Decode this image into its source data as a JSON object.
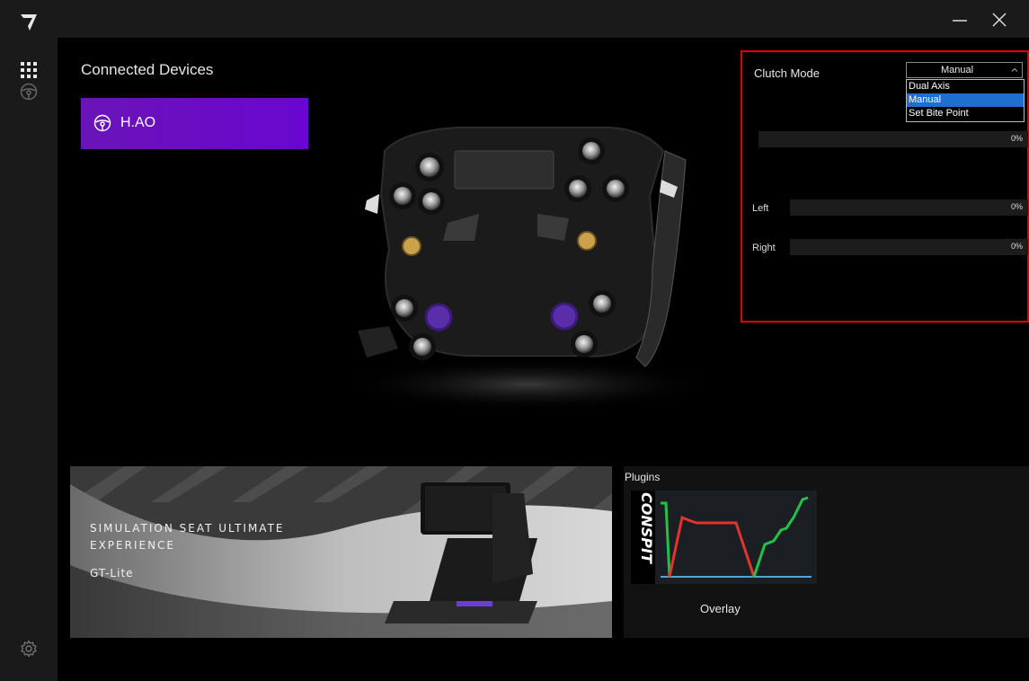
{
  "rail": {
    "logo": "conspit-logo",
    "icons": [
      "apps-grid-icon",
      "steering-wheel-icon",
      "gear-icon"
    ]
  },
  "window": {
    "minimize_icon": "minimize-icon",
    "close_icon": "close-icon"
  },
  "devices": {
    "heading": "Connected Devices",
    "items": [
      {
        "label": "H.AO",
        "icon": "steering-wheel-icon"
      }
    ]
  },
  "clutch": {
    "title": "Clutch Mode",
    "selected": "Manual",
    "options": [
      "Dual Axis",
      "Manual",
      "Set Bite Point"
    ],
    "main_bar": {
      "value_text": "0%",
      "value": 0
    },
    "left": {
      "label": "Left",
      "value_text": "0%",
      "value": 0
    },
    "right": {
      "label": "Right",
      "value_text": "0%",
      "value": 0
    },
    "highlight_color": "#e00000",
    "selected_option_color": "#1f6fd0"
  },
  "promo": {
    "line1": "SIMULATION SEAT  ULTIMATE",
    "line2": "EXPERIENCE",
    "line3": "GT-Lite"
  },
  "plugins": {
    "title": "Plugins",
    "items": [
      {
        "label": "Overlay",
        "brand": "CONSPIT"
      }
    ]
  },
  "colors": {
    "accent": "#6a06d0",
    "rail_bg": "#1a1a1a",
    "overlay_throttle": "#22c24a",
    "overlay_brake": "#e0342c",
    "overlay_clutch": "#4aa8d8"
  }
}
